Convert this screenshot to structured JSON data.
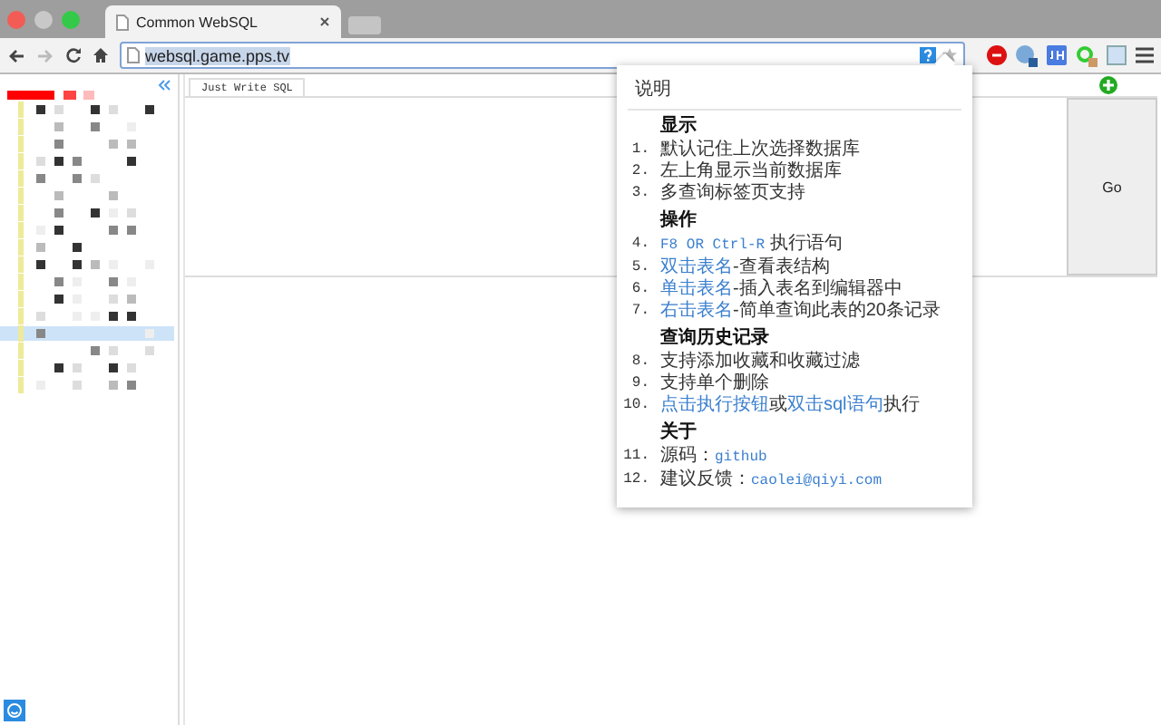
{
  "browser_tabs": [
    {
      "title": "Common WebSQL",
      "selected": true
    }
  ],
  "address_bar": {
    "url": "websql.game.pps.tv"
  },
  "editor_tabs": [
    {
      "label": "Just Write SQL",
      "selected": true
    }
  ],
  "run_button": {
    "label": "Go"
  },
  "help_popup": {
    "title": "说明",
    "sections": [
      {
        "heading": "显示",
        "items": [
          {
            "number": "1.",
            "parts": [
              {
                "text": "默认记住上次选择数据库",
                "kind": "plain"
              }
            ]
          },
          {
            "number": "2.",
            "parts": [
              {
                "text": "左上角显示当前数据库",
                "kind": "plain"
              }
            ]
          },
          {
            "number": "3.",
            "parts": [
              {
                "text": "多查询标签页支持",
                "kind": "plain"
              }
            ]
          }
        ]
      },
      {
        "heading": "操作",
        "items": [
          {
            "number": "4.",
            "parts": [
              {
                "text": "F8 OR Ctrl-R",
                "kind": "code"
              },
              {
                "text": " 执行语句",
                "kind": "plain"
              }
            ]
          },
          {
            "number": "5.",
            "parts": [
              {
                "text": "双击表名",
                "kind": "link"
              },
              {
                "text": "-查看表结构",
                "kind": "plain"
              }
            ]
          },
          {
            "number": "6.",
            "parts": [
              {
                "text": "单击表名",
                "kind": "link"
              },
              {
                "text": "-插入表名到编辑器中",
                "kind": "plain"
              }
            ]
          },
          {
            "number": "7.",
            "parts": [
              {
                "text": "右击表名",
                "kind": "link"
              },
              {
                "text": "-简单查询此表的20条记录",
                "kind": "plain"
              }
            ]
          }
        ]
      },
      {
        "heading": "查询历史记录",
        "items": [
          {
            "number": "8.",
            "parts": [
              {
                "text": "支持添加收藏和收藏过滤",
                "kind": "plain"
              }
            ]
          },
          {
            "number": "9.",
            "parts": [
              {
                "text": "支持单个删除",
                "kind": "plain"
              }
            ]
          },
          {
            "number": "10.",
            "parts": [
              {
                "text": "点击执行按钮",
                "kind": "link"
              },
              {
                "text": "或",
                "kind": "plain"
              },
              {
                "text": "双击sql语句",
                "kind": "link"
              },
              {
                "text": "执行",
                "kind": "plain"
              }
            ]
          }
        ]
      },
      {
        "heading": "关于",
        "items": [
          {
            "number": "11.",
            "parts": [
              {
                "text": "源码：",
                "kind": "plain"
              },
              {
                "text": "github",
                "kind": "code"
              }
            ]
          },
          {
            "number": "12.",
            "parts": [
              {
                "text": "建议反馈：",
                "kind": "plain"
              },
              {
                "text": "caolei@qiyi.com",
                "kind": "code"
              }
            ]
          }
        ]
      }
    ]
  }
}
